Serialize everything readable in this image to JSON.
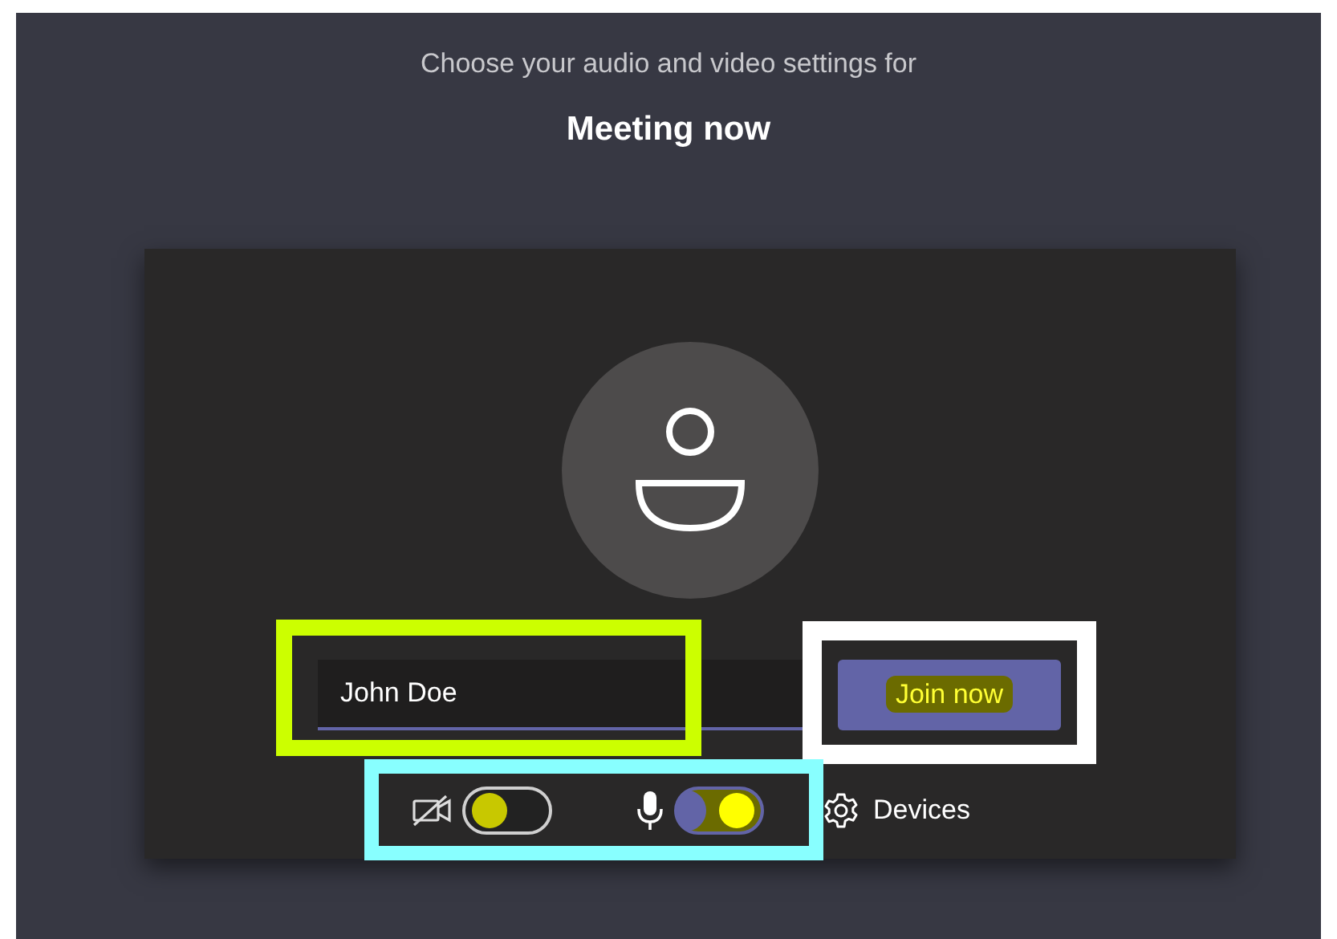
{
  "header": {
    "subtitle": "Choose your audio and video settings for",
    "title": "Meeting now"
  },
  "name_field": {
    "value": "John Doe"
  },
  "join_button": {
    "label": "Join now",
    "highlighted": true
  },
  "camera": {
    "on": false
  },
  "microphone": {
    "on": true
  },
  "devices_button": {
    "label": "Devices"
  },
  "annotations": [
    {
      "kind": "field",
      "color": "#ccff00"
    },
    {
      "kind": "button",
      "color": "#ffffff"
    },
    {
      "kind": "controls",
      "color": "#88ffff"
    }
  ]
}
